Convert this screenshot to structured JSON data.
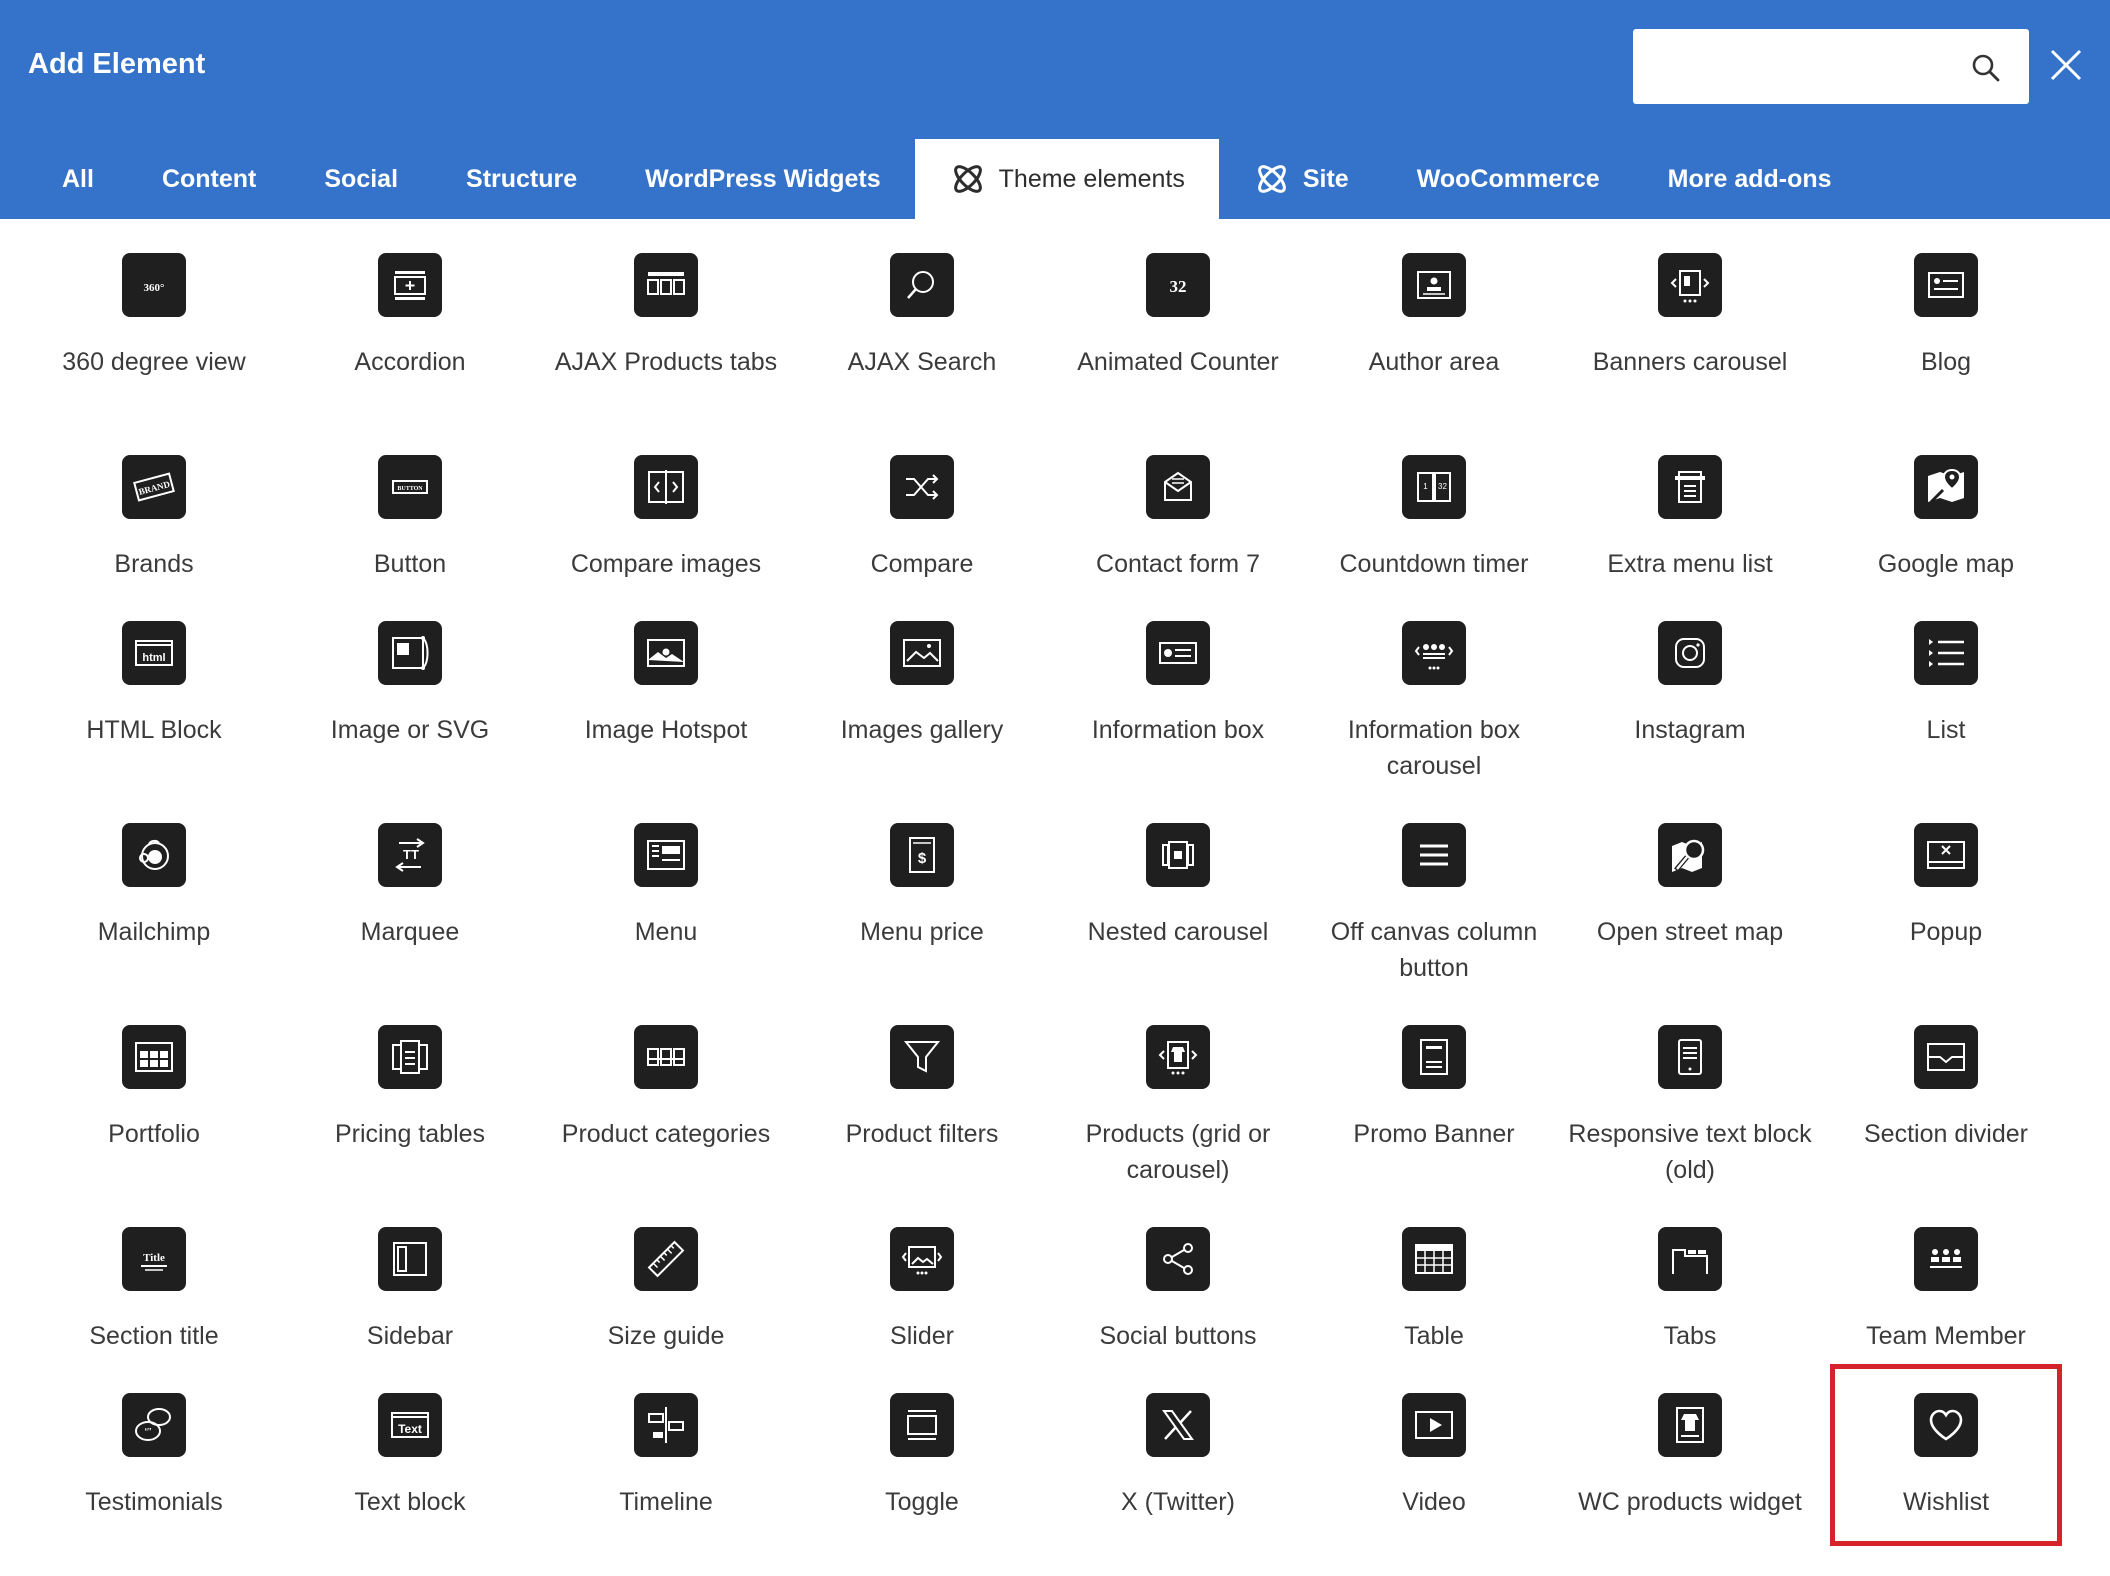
{
  "header": {
    "title": "Add Element",
    "search_placeholder": "",
    "search_icon": "search-icon",
    "close_icon": "close-icon"
  },
  "tabs": [
    {
      "label": "All"
    },
    {
      "label": "Content"
    },
    {
      "label": "Social"
    },
    {
      "label": "Structure"
    },
    {
      "label": "WordPress Widgets"
    },
    {
      "label": "Theme elements",
      "active": true,
      "icon": "theme-logo-icon"
    },
    {
      "label": "Site",
      "icon": "theme-logo-icon"
    },
    {
      "label": "WooCommerce"
    },
    {
      "label": "More add-ons"
    }
  ],
  "elements": [
    {
      "label": "360 degree view",
      "icon": "360-view-icon"
    },
    {
      "label": "Accordion",
      "icon": "accordion-icon"
    },
    {
      "label": "AJAX Products tabs",
      "icon": "ajax-products-tabs-icon"
    },
    {
      "label": "AJAX Search",
      "icon": "search-icon"
    },
    {
      "label": "Animated Counter",
      "icon": "counter-icon"
    },
    {
      "label": "Author area",
      "icon": "author-icon"
    },
    {
      "label": "Banners carousel",
      "icon": "banners-carousel-icon"
    },
    {
      "label": "Blog",
      "icon": "blog-icon"
    },
    {
      "label": "Brands",
      "icon": "brand-tag-icon"
    },
    {
      "label": "Button",
      "icon": "button-icon"
    },
    {
      "label": "Compare images",
      "icon": "compare-images-icon"
    },
    {
      "label": "Compare",
      "icon": "shuffle-icon"
    },
    {
      "label": "Contact form 7",
      "icon": "envelope-icon"
    },
    {
      "label": "Countdown timer",
      "icon": "countdown-icon"
    },
    {
      "label": "Extra menu list",
      "icon": "menu-list-icon"
    },
    {
      "label": "Google map",
      "icon": "google-map-icon"
    },
    {
      "label": "HTML Block",
      "icon": "html-icon"
    },
    {
      "label": "Image or SVG",
      "icon": "image-icon"
    },
    {
      "label": "Image Hotspot",
      "icon": "hotspot-icon"
    },
    {
      "label": "Images gallery",
      "icon": "gallery-icon"
    },
    {
      "label": "Information box",
      "icon": "info-box-icon"
    },
    {
      "label": "Information box carousel",
      "icon": "info-carousel-icon"
    },
    {
      "label": "Instagram",
      "icon": "instagram-icon"
    },
    {
      "label": "List",
      "icon": "list-icon"
    },
    {
      "label": "Mailchimp",
      "icon": "mailchimp-icon"
    },
    {
      "label": "Marquee",
      "icon": "marquee-icon"
    },
    {
      "label": "Menu",
      "icon": "menu-icon"
    },
    {
      "label": "Menu price",
      "icon": "menu-price-icon"
    },
    {
      "label": "Nested carousel",
      "icon": "nested-carousel-icon"
    },
    {
      "label": "Off canvas column button",
      "icon": "hamburger-icon"
    },
    {
      "label": "Open street map",
      "icon": "map-search-icon"
    },
    {
      "label": "Popup",
      "icon": "popup-icon"
    },
    {
      "label": "Portfolio",
      "icon": "portfolio-icon"
    },
    {
      "label": "Pricing tables",
      "icon": "pricing-icon"
    },
    {
      "label": "Product categories",
      "icon": "categories-icon"
    },
    {
      "label": "Product filters",
      "icon": "filter-icon"
    },
    {
      "label": "Products (grid or carousel)",
      "icon": "products-icon"
    },
    {
      "label": "Promo Banner",
      "icon": "promo-banner-icon"
    },
    {
      "label": "Responsive text block (old)",
      "icon": "responsive-text-icon"
    },
    {
      "label": "Section divider",
      "icon": "divider-icon"
    },
    {
      "label": "Section title",
      "icon": "title-icon"
    },
    {
      "label": "Sidebar",
      "icon": "sidebar-icon"
    },
    {
      "label": "Size guide",
      "icon": "ruler-icon"
    },
    {
      "label": "Slider",
      "icon": "slider-icon"
    },
    {
      "label": "Social buttons",
      "icon": "share-icon"
    },
    {
      "label": "Table",
      "icon": "table-icon"
    },
    {
      "label": "Tabs",
      "icon": "tabs-icon"
    },
    {
      "label": "Team Member",
      "icon": "team-icon"
    },
    {
      "label": "Testimonials",
      "icon": "testimonials-icon"
    },
    {
      "label": "Text block",
      "icon": "text-icon"
    },
    {
      "label": "Timeline",
      "icon": "timeline-icon"
    },
    {
      "label": "Toggle",
      "icon": "toggle-icon"
    },
    {
      "label": "X (Twitter)",
      "icon": "x-icon"
    },
    {
      "label": "Video",
      "icon": "video-icon"
    },
    {
      "label": "WC products widget",
      "icon": "wc-products-icon"
    },
    {
      "label": "Wishlist",
      "icon": "heart-icon",
      "highlighted": true
    }
  ],
  "glyph_text": {
    "view360": "360°",
    "counter": "32",
    "brand": "BRAND",
    "button": "BUTTON",
    "html": "html",
    "menu_price": "$",
    "title": "Title",
    "text": "Text",
    "countdown_a": "1",
    "countdown_b": "32"
  },
  "colors": {
    "header_bg": "#3572c9",
    "icon_bg": "#1f1f1f",
    "highlight": "#d6232a",
    "label": "#3b3b3b"
  }
}
